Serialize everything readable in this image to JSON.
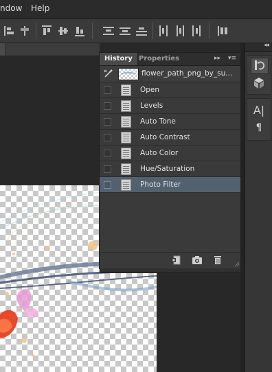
{
  "menubar": {
    "items": [
      "ndow",
      "Help"
    ]
  },
  "panel": {
    "tabs": [
      {
        "label": "History"
      },
      {
        "label": "Properties"
      }
    ],
    "menu_glyphs": {
      "expand": "▸▸",
      "menu": "▾≡"
    },
    "snapshot": {
      "label": "flower_path_png_by_su..."
    },
    "steps": [
      {
        "label": "Open"
      },
      {
        "label": "Levels"
      },
      {
        "label": "Auto Tone"
      },
      {
        "label": "Auto Contrast"
      },
      {
        "label": "Auto Color"
      },
      {
        "label": "Hue/Saturation"
      },
      {
        "label": "Photo Filter",
        "selected": true
      }
    ],
    "footer_buttons": [
      "new-document-from-state",
      "new-snapshot",
      "delete-state"
    ]
  },
  "dock": {
    "collapse_glyph": "◂◂",
    "buttons": [
      {
        "icon": "history-panel-icon",
        "active": true
      },
      {
        "icon": "3d-cube-icon"
      },
      {
        "icon": "character-panel-icon",
        "glyph": "A|"
      },
      {
        "icon": "paragraph-panel-icon",
        "glyph": "¶"
      }
    ]
  },
  "colors": {
    "selected_row": "#52616f",
    "panel_bg": "#3a3a3a",
    "canvas_bg": "#282828"
  }
}
